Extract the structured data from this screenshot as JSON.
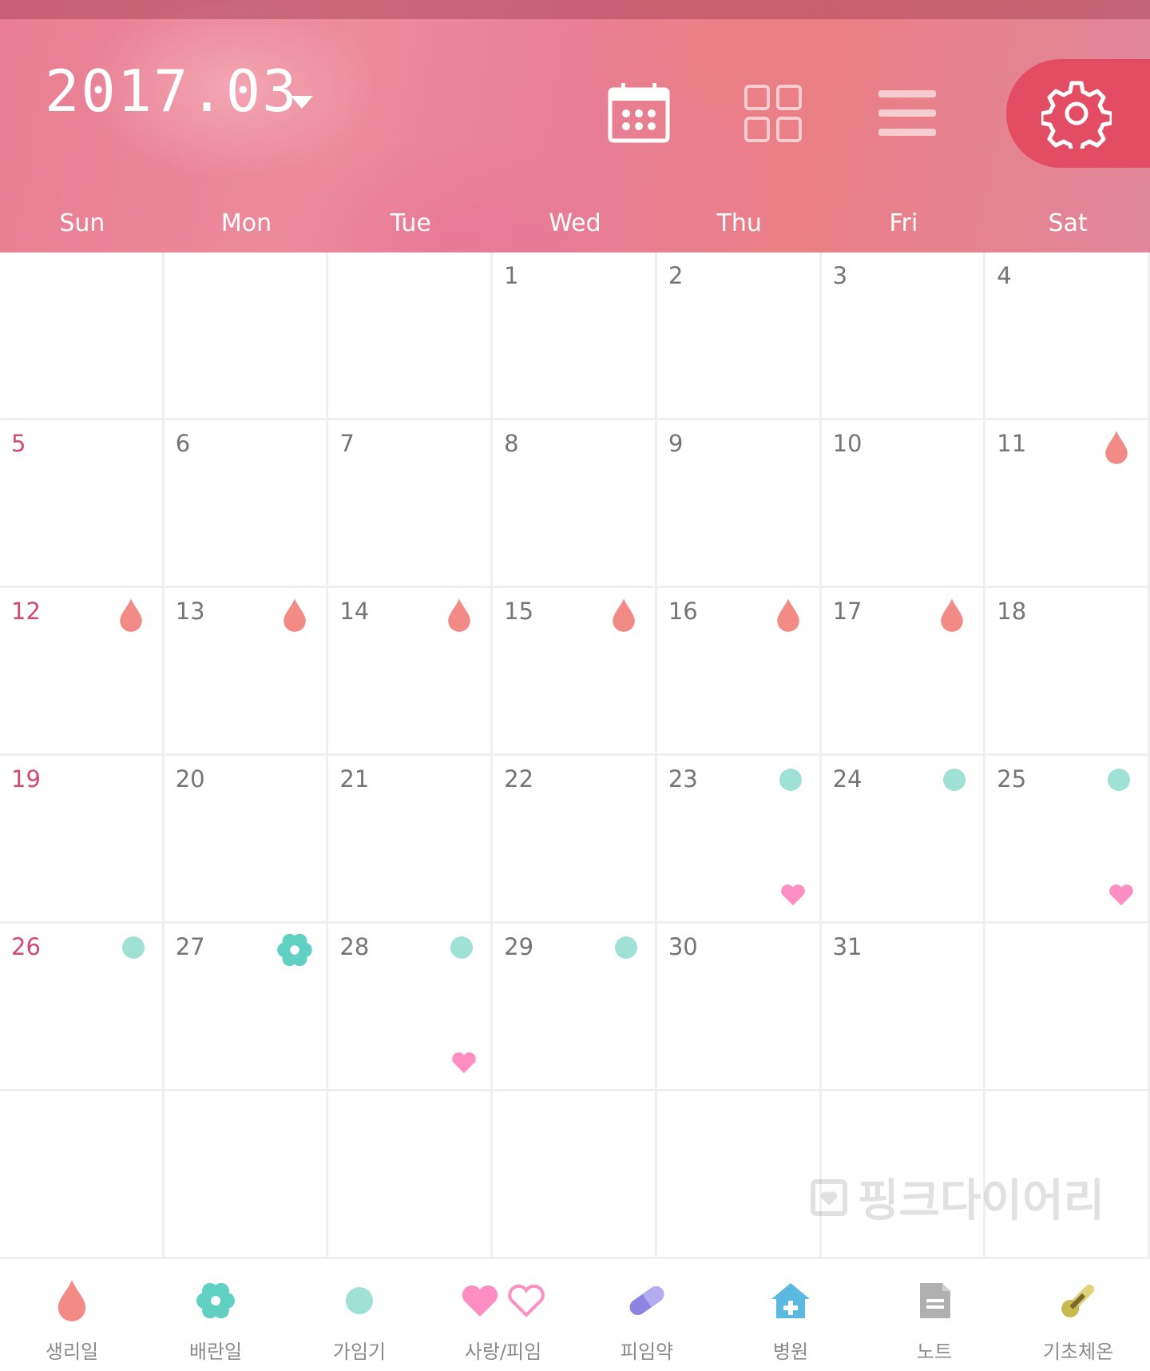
{
  "header": {
    "title": "2017.03",
    "views": [
      {
        "name": "calendar-view-button",
        "icon": "calendar-icon"
      },
      {
        "name": "grid-view-button",
        "icon": "grid-icon"
      },
      {
        "name": "list-view-button",
        "icon": "menu-icon"
      },
      {
        "name": "settings-button",
        "icon": "gear-icon"
      }
    ]
  },
  "weekdays": [
    "Sun",
    "Mon",
    "Tue",
    "Wed",
    "Thu",
    "Fri",
    "Sat"
  ],
  "colors": {
    "period": "#f28b86",
    "fertile": "#9fe1d5",
    "ovulation": "#5fd0c1",
    "love": "#ff8fc2",
    "sunday": "#d24a72",
    "day_text": "#757575",
    "accent": "#e24d63"
  },
  "calendar": {
    "first_weekday": 3,
    "days_in_month": 31,
    "rows": 6,
    "markers": {
      "11": [
        "period"
      ],
      "12": [
        "period"
      ],
      "13": [
        "period"
      ],
      "14": [
        "period"
      ],
      "15": [
        "period"
      ],
      "16": [
        "period"
      ],
      "17": [
        "period"
      ],
      "23": [
        "fertile",
        "love"
      ],
      "24": [
        "fertile"
      ],
      "25": [
        "fertile",
        "love"
      ],
      "26": [
        "fertile"
      ],
      "27": [
        "ovulation"
      ],
      "28": [
        "fertile",
        "love"
      ],
      "29": [
        "fertile"
      ]
    }
  },
  "watermark": "핑크다이어리",
  "legend": [
    {
      "key": "period",
      "label": "생리일",
      "icon": "drop-icon"
    },
    {
      "key": "ovulation",
      "label": "배란일",
      "icon": "flower-icon"
    },
    {
      "key": "fertile",
      "label": "가임기",
      "icon": "circle-icon"
    },
    {
      "key": "love",
      "label": "사랑/피임",
      "icon": "heart-icon"
    },
    {
      "key": "pill",
      "label": "피임약",
      "icon": "pill-icon"
    },
    {
      "key": "hospital",
      "label": "병원",
      "icon": "hospital-icon"
    },
    {
      "key": "note",
      "label": "노트",
      "icon": "note-icon"
    },
    {
      "key": "temperature",
      "label": "기초체온",
      "icon": "thermometer-icon"
    }
  ]
}
